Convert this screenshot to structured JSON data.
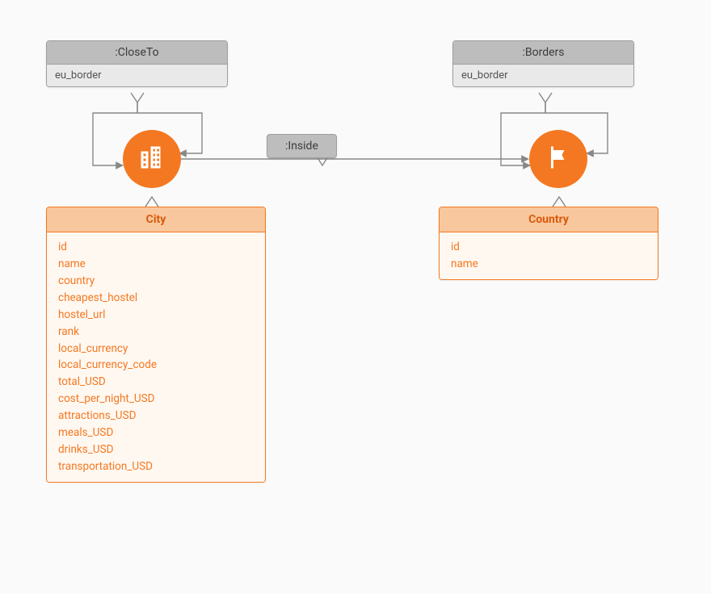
{
  "relationships": {
    "closeTo": {
      "label": ":CloseTo",
      "property": "eu_border"
    },
    "borders": {
      "label": ":Borders",
      "property": "eu_border"
    },
    "inside": {
      "label": ":Inside"
    }
  },
  "nodes": {
    "city": {
      "label": "City",
      "icon": "buildings-icon"
    },
    "country": {
      "label": "Country",
      "icon": "flag-icon"
    }
  },
  "entities": {
    "city": {
      "title": "City",
      "properties": [
        "id",
        "name",
        "country",
        "cheapest_hostel",
        "hostel_url",
        "rank",
        "local_currency",
        "local_currency_code",
        "total_USD",
        "cost_per_night_USD",
        "attractions_USD",
        "meals_USD",
        "drinks_USD",
        "transportation_USD"
      ]
    },
    "country": {
      "title": "Country",
      "properties": [
        "id",
        "name"
      ]
    }
  }
}
